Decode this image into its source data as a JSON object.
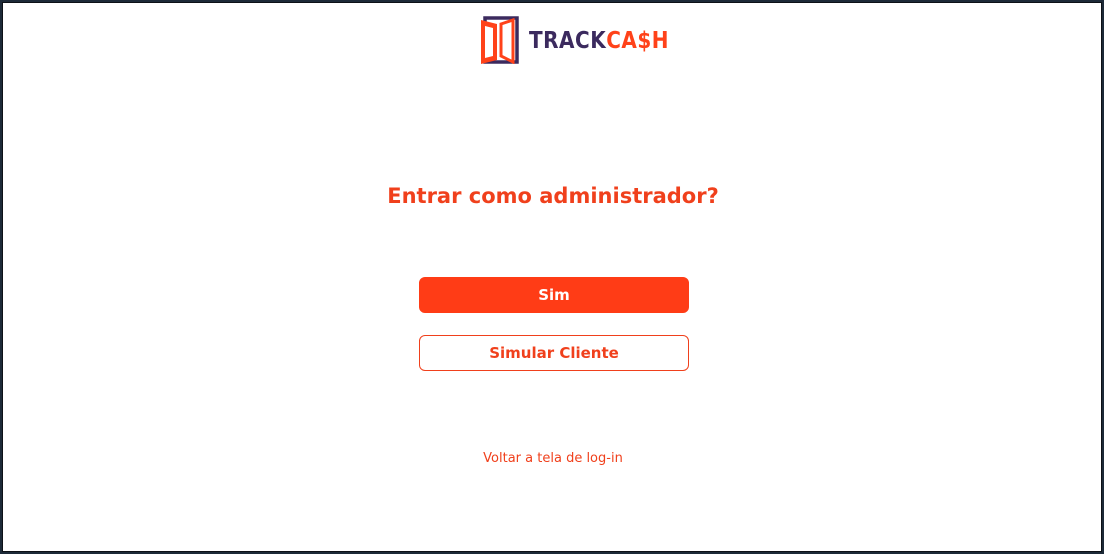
{
  "brand": {
    "name_part1": "TRACK",
    "name_part2": "CA$H",
    "icon": "open-door-logo-icon",
    "color_primary": "#3b2a5e",
    "color_accent": "#ff4219"
  },
  "dialog": {
    "title": "Entrar como administrador?",
    "confirm_label": "Sim",
    "simulate_label": "Simular Cliente",
    "back_link": "Voltar a tela de log-in"
  },
  "colors": {
    "accent": "#ff3c16",
    "background": "#ffffff"
  }
}
